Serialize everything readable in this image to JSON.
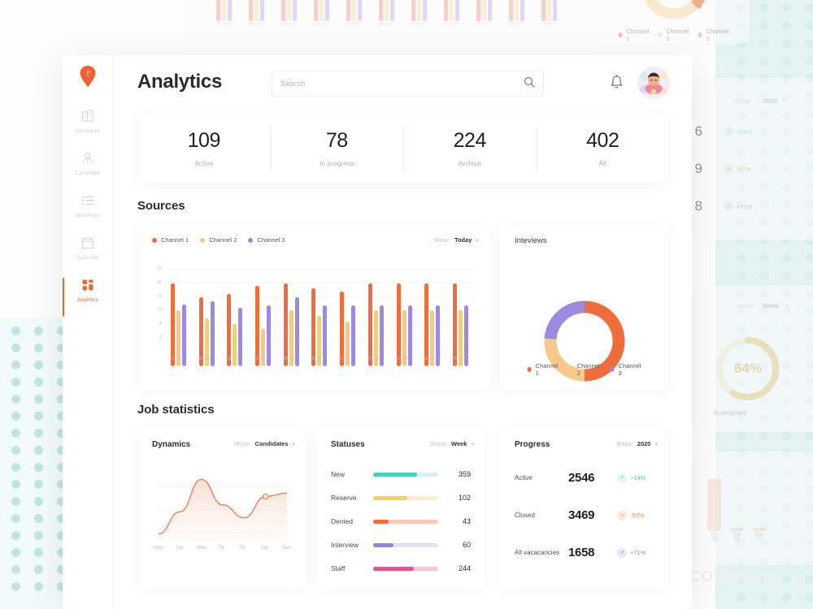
{
  "app": {
    "logo_icon": "map-pin-logo",
    "page_title": "Analytics",
    "search": {
      "placeholder": "Search",
      "value": "",
      "icon": "search-icon"
    },
    "bell_icon": "bell-icon",
    "avatar_icon": "user-avatar"
  },
  "sidebar": {
    "items": [
      {
        "label": "Companie",
        "icon": "buildings-icon",
        "active": false
      },
      {
        "label": "Candidate",
        "icon": "person-icon",
        "active": false
      },
      {
        "label": "Vacancies",
        "icon": "list-icon",
        "active": false
      },
      {
        "label": "Calendar",
        "icon": "calendar-icon",
        "active": false
      },
      {
        "label": "Analitics",
        "icon": "grid-squares-icon",
        "active": true
      }
    ]
  },
  "stats": [
    {
      "value": "109",
      "label": "Active"
    },
    {
      "value": "78",
      "label": "In progress"
    },
    {
      "value": "224",
      "label": "Archive"
    },
    {
      "value": "402",
      "label": "All"
    }
  ],
  "sections": {
    "sources": "Sources",
    "job_statistics": "Job statistics"
  },
  "colors": {
    "channel1": "#ef6c3c",
    "channel2": "#f2cd7f",
    "channel3": "#9b8ae0",
    "accent": "#e8663c",
    "teal": "#4ecdc4",
    "yellow": "#f3d35e",
    "purple": "#9b7fe0",
    "pink": "#e0558c"
  },
  "sources_card": {
    "legend": [
      {
        "label": "Channel 1",
        "color": "#ef6c3c"
      },
      {
        "label": "Channel 2",
        "color": "#f2cd7f"
      },
      {
        "label": "Channel 3",
        "color": "#9b8ae0"
      }
    ],
    "show_label": "Show:",
    "show_value": "Today"
  },
  "donut_card": {
    "title": "Inteviews",
    "legend": [
      {
        "label": "Channel 1",
        "color": "#ef6c3c"
      },
      {
        "label": "Channel 2",
        "color": "#f2cd7f"
      },
      {
        "label": "Channel 3",
        "color": "#9b8ae0"
      }
    ]
  },
  "dynamics_card": {
    "title": "Dynamics",
    "show_label": "Show:",
    "show_value": "Condidates"
  },
  "statuses_card": {
    "title": "Statuses",
    "show_label": "Show:",
    "show_value": "Week",
    "rows": [
      {
        "name": "New",
        "value": "359",
        "pct": 68,
        "color": "#4ecdc4",
        "track": "#d6f2f0"
      },
      {
        "name": "Reserve",
        "value": "102",
        "pct": 52,
        "color": "#f3d35e",
        "track": "#faeecb"
      },
      {
        "name": "Denied",
        "value": "43",
        "pct": 24,
        "color": "#ef6c3c",
        "track": "#f9cbb8"
      },
      {
        "name": "Interview",
        "value": "60",
        "pct": 31,
        "color": "#9b7fe0",
        "track": "#e3e0f2"
      },
      {
        "name": "Staff",
        "value": "244",
        "pct": 63,
        "color": "#e0558c",
        "track": "#f8c8d6"
      }
    ]
  },
  "progress_card": {
    "title": "Progress",
    "show_label": "Show:",
    "show_value": "2020",
    "rows": [
      {
        "name": "Active",
        "value": "2546",
        "delta": "+14%",
        "dir": "up",
        "color": "#4ecdc4",
        "bg": "#e3f7f5"
      },
      {
        "name": "Closed",
        "value": "3469",
        "delta": "-57%",
        "dir": "down",
        "color": "#ef8a3c",
        "bg": "#fdeadf"
      },
      {
        "name": "All vacacancies",
        "value": "1658",
        "delta": "+71%",
        "dir": "up",
        "color": "#9b7fe0",
        "bg": "#ebe7f9"
      }
    ]
  },
  "chart_data": [
    {
      "type": "bar",
      "title": "Sources",
      "xlabel": "",
      "ylabel": "",
      "ylim": [
        0,
        13
      ],
      "yticks": [
        2,
        4,
        6,
        8,
        10,
        12
      ],
      "grid": true,
      "legend_position": "top-left",
      "categories": [
        "01 / 07",
        "02 / 07",
        "03 / 07",
        "04 / 07",
        "05 / 07",
        "06 / 07",
        "07 / 07",
        "07 / 07",
        "07 / 07",
        "07 / 07",
        "07 / 07"
      ],
      "series": [
        {
          "name": "Channel 1",
          "color": "#ef6c3c",
          "values": [
            12,
            10,
            10.5,
            11.7,
            12,
            11.3,
            10.9,
            12,
            12,
            12,
            12
          ]
        },
        {
          "name": "Channel 2",
          "color": "#f2cd7f",
          "values": [
            8.1,
            7,
            6.1,
            5.4,
            8.1,
            7.3,
            6.5,
            8.1,
            8.2,
            8.1,
            8.1
          ]
        },
        {
          "name": "Channel 3",
          "color": "#9b8ae0",
          "values": [
            9,
            9.5,
            8.5,
            8.9,
            10,
            8.9,
            8.9,
            8.9,
            8.9,
            8.9,
            8.9
          ]
        }
      ]
    },
    {
      "type": "pie",
      "title": "Inteviews",
      "labels": [
        "Channel 1",
        "Channel 2",
        "Channel 3"
      ],
      "values": [
        50,
        26,
        24
      ],
      "colors": [
        "#ef6c3c",
        "#f7c98a",
        "#9b8ae0"
      ],
      "legend_position": "bottom"
    },
    {
      "type": "area",
      "title": "Dynamics",
      "x": [
        "Mon",
        "Tue",
        "Wed",
        "Th",
        "Fri",
        "Sat",
        "Sun"
      ],
      "values": [
        8,
        34,
        72,
        42,
        27,
        52,
        56
      ],
      "color": "#e8875f",
      "grid": true,
      "xlabel": "",
      "ylabel": ""
    },
    {
      "type": "bar",
      "title": "Statuses",
      "categories": [
        "New",
        "Reserve",
        "Denied",
        "Interview",
        "Staff"
      ],
      "values": [
        359,
        102,
        43,
        60,
        244
      ],
      "colors": [
        "#4ecdc4",
        "#f3d35e",
        "#ef6c3c",
        "#9b7fe0",
        "#e0558c"
      ],
      "xlabel": "",
      "ylabel": ""
    }
  ],
  "background": {
    "top_chart_xlabels": [
      "01 / 07",
      "02 / 07",
      "03 / 07",
      "04 / 07",
      "05 / 07",
      "06 / 07",
      "07 / 07",
      "07 / 07",
      "07 / 07",
      "07 / 07",
      "07 / 07"
    ],
    "top_donut_legend": [
      "Channel 1",
      "Channel 2",
      "Channel 3"
    ],
    "right_progress": {
      "show_label": "Show:",
      "show_value": "2020",
      "rows": [
        {
          "value": "6",
          "delta": "+14%"
        },
        {
          "value": "9",
          "delta": "-57%"
        },
        {
          "value": "8",
          "delta": "+71%"
        }
      ]
    },
    "right_gauge": {
      "show_label": "Show:",
      "show_value": "Week",
      "value": "64%",
      "caption": "In progress"
    },
    "right_bars": [
      {
        "day": "Fri",
        "date": "25"
      },
      {
        "day": "Sat",
        "date": "26"
      },
      {
        "day": "Sun",
        "date": "27"
      }
    ],
    "watermark": "STOCOPEN.co"
  }
}
